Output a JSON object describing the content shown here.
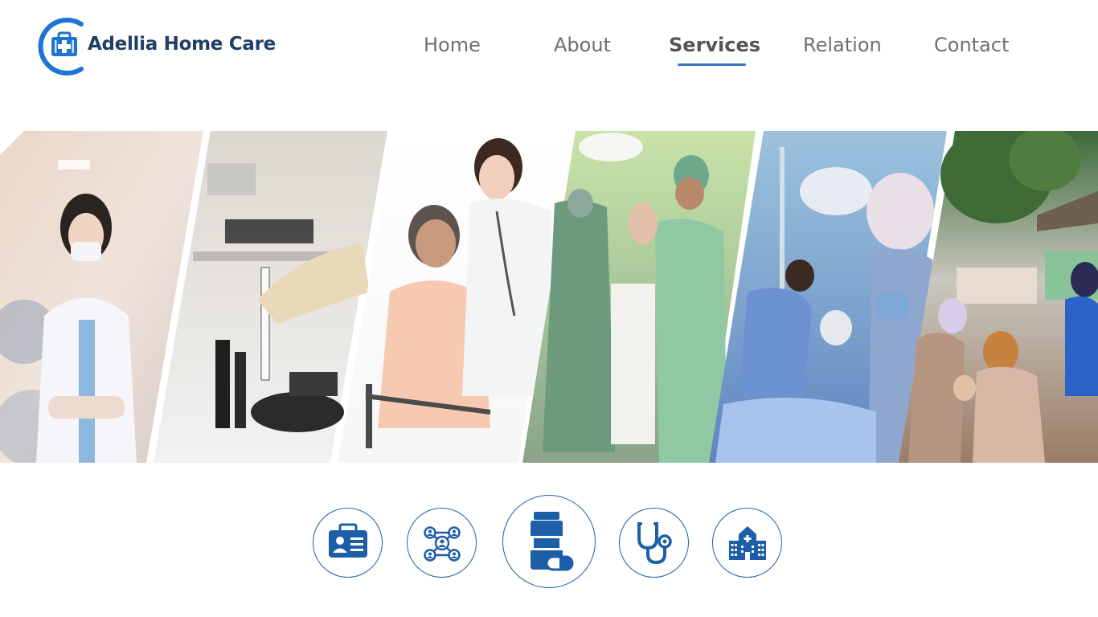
{
  "brand": {
    "name": "Adellia Home Care",
    "logo_icon": "medical-bag-icon",
    "primary_color": "#1e74d3",
    "text_color": "#1f3f66"
  },
  "nav": {
    "items": [
      {
        "label": "Home",
        "active": false
      },
      {
        "label": "About",
        "active": false
      },
      {
        "label": "Services",
        "active": true
      },
      {
        "label": "Relation",
        "active": false
      },
      {
        "label": "Contact",
        "active": false
      }
    ],
    "active_underline_color": "#3c73c8"
  },
  "banner": {
    "panels": [
      "nurse-with-mask-photo",
      "lab-equipment-photo",
      "nurse-with-elderly-patient-photo",
      "operating-room-newborn-photo",
      "surgery-team-photo",
      "community-health-outreach-photo"
    ]
  },
  "services": {
    "icons": [
      "id-card-icon",
      "network-people-icon",
      "medicine-bottle-icon",
      "stethoscope-icon",
      "hospital-building-icon"
    ],
    "selected_index": 2,
    "icon_color": "#1c5fa8"
  }
}
